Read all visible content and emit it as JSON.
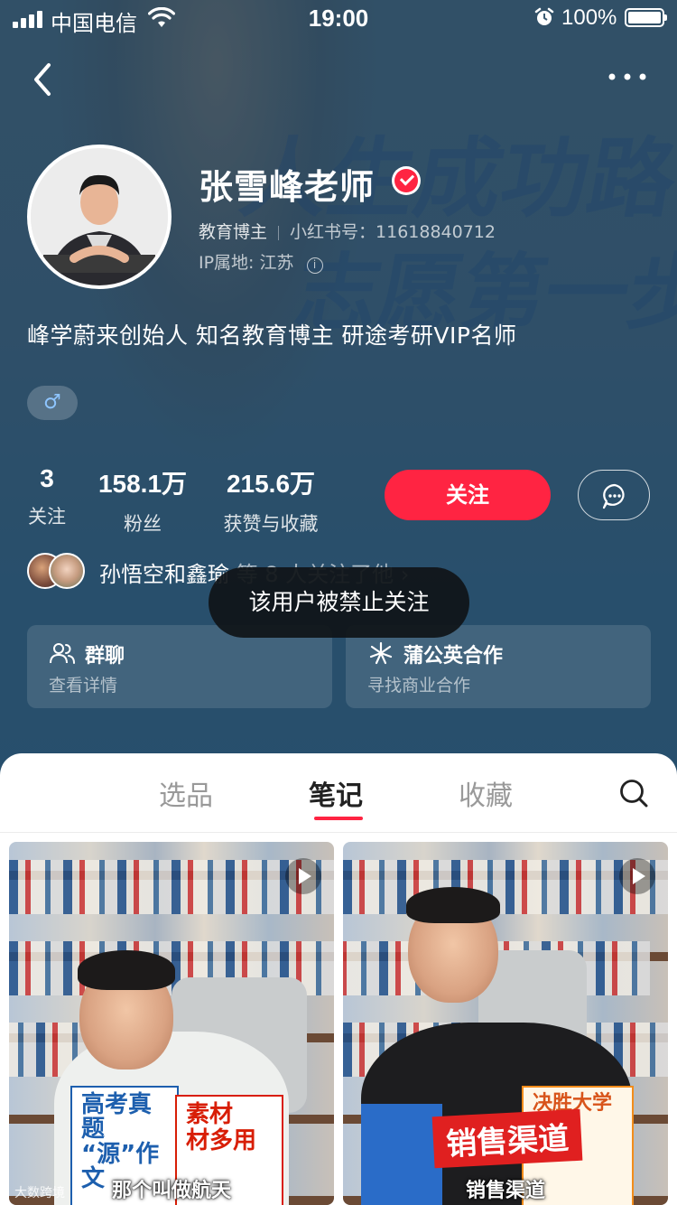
{
  "status_bar": {
    "carrier": "中国电信",
    "time": "19:00",
    "battery": "100%"
  },
  "background": {
    "slogan_line1": "人生成功路",
    "slogan_line2": "志愿第一步"
  },
  "profile": {
    "name": "张雪峰老师",
    "role": "教育博主",
    "red_id": "小红书号：11618840712",
    "ip_location": "IP属地: 江苏",
    "bio": "峰学蔚来创始人 知名教育博主 研途考研VIP名师",
    "gender_symbol": "♂"
  },
  "stats": [
    {
      "value": "3",
      "label": "关注"
    },
    {
      "value": "158.1万",
      "label": "粉丝"
    },
    {
      "value": "215.6万",
      "label": "获赞与收藏"
    }
  ],
  "actions": {
    "follow_label": "关注"
  },
  "mutual_followers": {
    "names": "孙悟空和鑫瑜",
    "rest": " 等 8 人关注了他 ›"
  },
  "cards": [
    {
      "title": "群聊",
      "subtitle": "查看详情",
      "icon": "group-icon"
    },
    {
      "title": "蒲公英合作",
      "subtitle": "寻找商业合作",
      "icon": "dandelion-icon"
    }
  ],
  "toast": "该用户被禁止关注",
  "tabs": [
    {
      "label": "选品"
    },
    {
      "label": "笔记"
    },
    {
      "label": "收藏"
    }
  ],
  "active_tab": "笔记",
  "notes": [
    {
      "cover_line1": "高考真题",
      "cover_line2": "“源”作文",
      "cover_red1": "素材",
      "cover_red2": "材多用",
      "caption": "那个叫做航天",
      "watermark": "大数跨境"
    },
    {
      "banner": "销售渠道",
      "cover_text": "决胜大学",
      "caption": "销售渠道"
    }
  ],
  "colors": {
    "accent": "#ff2442",
    "header_bg": "#2d5a7a",
    "toast_bg": "#101418"
  }
}
